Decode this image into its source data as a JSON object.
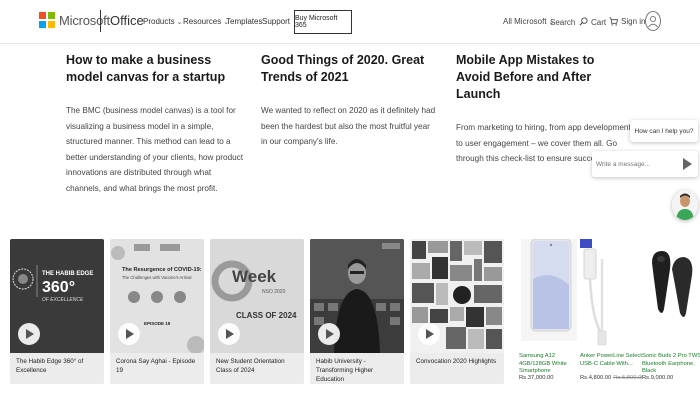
{
  "header": {
    "brand": "Microsoft",
    "product": "Office",
    "nav": [
      {
        "label": "Products",
        "has_dropdown": true
      },
      {
        "label": "Resources",
        "has_dropdown": true
      },
      {
        "label": "Templates",
        "has_dropdown": false
      },
      {
        "label": "Support",
        "has_dropdown": false
      }
    ],
    "buy_button": "Buy Microsoft 365",
    "all_microsoft": "All Microsoft",
    "search": "Search",
    "cart": "Cart",
    "sign_in": "Sign in",
    "logo_colors": [
      "#f25022",
      "#7fba00",
      "#00a4ef",
      "#ffb900"
    ]
  },
  "articles": [
    {
      "title": "How to make a business model canvas for a startup",
      "body": "The BMC (business model canvas) is a tool for visualizing a business model in a simple, structured manner. This method can lead to a better understanding of your clients, how product innovations are distributed through what channels, and what brings the most profit."
    },
    {
      "title": "Good Things of 2020. Great Trends of 2021",
      "body": "We wanted to reflect on 2020 as it definitely had been the hardest but also the most fruitful year in our company's life."
    },
    {
      "title": "Mobile App Mistakes to Avoid Before and After Launch",
      "body": "From marketing to hiring, from app development to user engagement – we cover them all. Go through this check-list to ensure success!"
    }
  ],
  "chat": {
    "prompt": "How can I help you?",
    "placeholder": "Write a message..."
  },
  "videos": [
    {
      "caption": "The Habib Edge 360° of Excellence",
      "thumb_title": "THE HABIB EDGE",
      "thumb_big": "360°",
      "thumb_sub": "OF EXCELLENCE"
    },
    {
      "caption": "Corona Say Aghai - Episode 19",
      "thumb_title": "The Resurgence of COVID-19:",
      "thumb_sub": "The Challenges with Vaccine's Arrival",
      "thumb_tag": "EPISODE 19"
    },
    {
      "caption": "New Student Orientation Class of 2024",
      "thumb_big": "Week",
      "thumb_sub": "NSO 2020",
      "thumb_title": "CLASS OF 2024"
    },
    {
      "caption": "Habib University - Transforming Higher Education"
    },
    {
      "caption": "Convocation 2020 Highlights"
    }
  ],
  "products": [
    {
      "name": "Samsung A12 4GB/128GB White Smartphone",
      "price": "Rs.37,000.00",
      "old_price": ""
    },
    {
      "name": "Anker PowerLine Select USB-C Cable With...",
      "price": "Rs.4,800.00",
      "old_price": "Rs.5,800.00"
    },
    {
      "name": "Sonic Buds 2 Pro TWS Bluetooth Earphone, Black",
      "price": "Rs.9,000.00",
      "old_price": ""
    }
  ]
}
